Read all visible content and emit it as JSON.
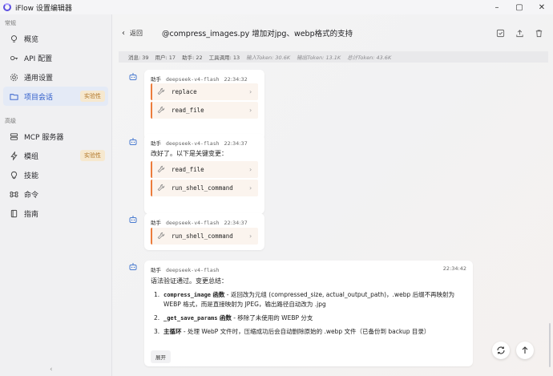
{
  "app": {
    "title": "iFlow 设置编辑器"
  },
  "sidebar": {
    "sections": [
      {
        "label": "常规"
      },
      {
        "label": "高级"
      }
    ],
    "general_items": [
      {
        "label": "概览",
        "icon": "lightbulb-icon"
      },
      {
        "label": "API 配置",
        "icon": "key-icon"
      },
      {
        "label": "通用设置",
        "icon": "gear-icon"
      },
      {
        "label": "项目会话",
        "icon": "folder-icon",
        "badge": "实验性",
        "active": true
      }
    ],
    "advanced_items": [
      {
        "label": "MCP 服务器",
        "icon": "server-icon"
      },
      {
        "label": "模组",
        "icon": "lightning-icon",
        "badge": "实验性"
      },
      {
        "label": "技能",
        "icon": "bulb-icon"
      },
      {
        "label": "命令",
        "icon": "command-icon"
      },
      {
        "label": "指南",
        "icon": "book-icon"
      }
    ],
    "collapse_glyph": "‹"
  },
  "header": {
    "back_label": "返回",
    "title": "@compress_images.py 增加对jpg、webp格式的支持"
  },
  "stats": {
    "messages": "消息: 39",
    "user": "用户: 17",
    "assistant": "助手: 22",
    "tool_calls": "工具调用: 13",
    "input_tokens": "输入Token: 30.6K",
    "output_tokens": "输出Token: 13.1K",
    "total_tokens": "总计Token: 43.6K"
  },
  "messages": [
    {
      "role": "助手",
      "model": "deepseek-v4-flash",
      "time": "22:34:32",
      "tools": [
        "replace",
        "read_file"
      ]
    },
    {
      "role": "助手",
      "model": "deepseek-v4-flash",
      "time": "22:34:37",
      "text": "改好了。以下是关键变更：",
      "tools": [
        "read_file",
        "run_shell_command"
      ]
    },
    {
      "role": "助手",
      "model": "deepseek-v4-flash",
      "time": "22:34:37",
      "tools": [
        "run_shell_command"
      ]
    },
    {
      "role": "助手",
      "model": "deepseek-v4-flash",
      "time": "22:34:42",
      "text": "语法验证通过。变更总结：",
      "list": [
        {
          "num": "1.",
          "code": "compress_image",
          "strong": "函数",
          "body": " - 返回改为元组 (compressed_size, actual_output_path)，.webp 后缀不再映射为 WEBP 格式，而是直接映射为 JPEG，输出路径自动改为 .jpg"
        },
        {
          "num": "2.",
          "code": "_get_save_params",
          "strong": "函数",
          "body": " - 移除了未使用的 WEBP 分支"
        },
        {
          "num": "3.",
          "code": "",
          "strong": "主循环",
          "body": " - 处理 WebP 文件时，压缩成功后会自动删除原始的 .webp 文件（已备份到 backup 目录）"
        }
      ],
      "expand_label": "展开"
    }
  ],
  "colors": {
    "accent": "#2a59c9",
    "tool_border": "#ec7c3c",
    "badge_bg": "#f6e8cf",
    "badge_text": "#b1772a"
  }
}
